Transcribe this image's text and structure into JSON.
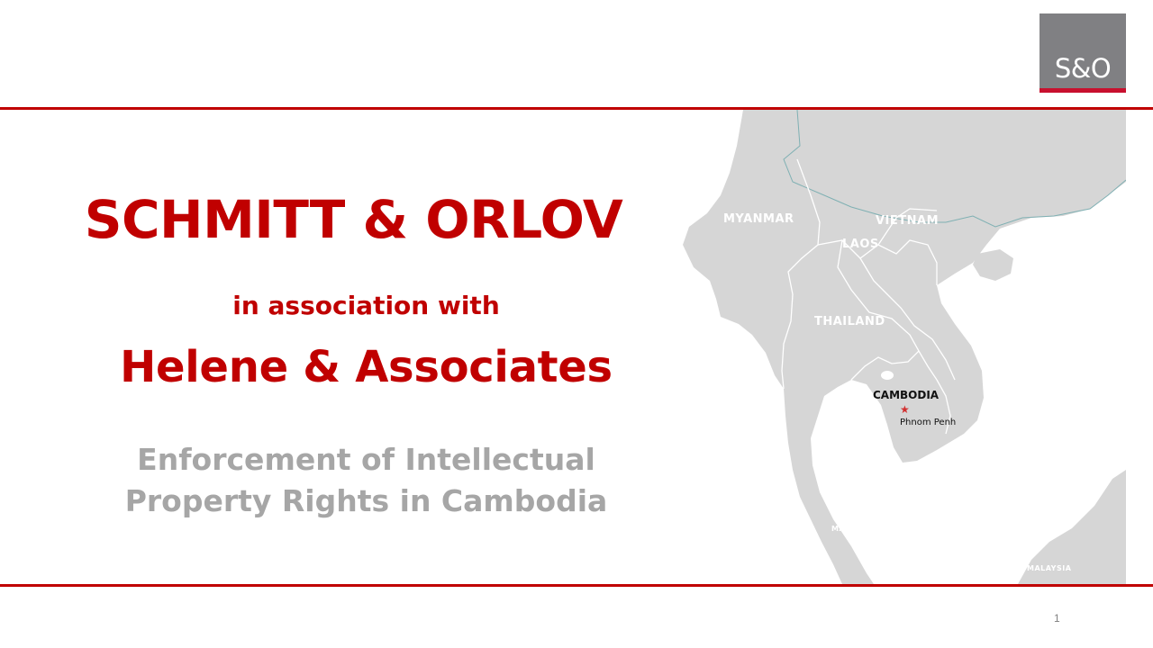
{
  "logo": {
    "text": "S&O"
  },
  "title": {
    "firm": "SCHMITT & ORLOV",
    "association": "in association with",
    "partner": "Helene & Associates"
  },
  "subtitle": {
    "line1": "Enforcement of Intellectual",
    "line2": "Property Rights in Cambodia"
  },
  "map": {
    "labels": {
      "myanmar": "MYANMAR",
      "vietnam": "VIETNAM",
      "laos": "LAOS",
      "thailand": "THAILAND",
      "cambodia": "CAMBODIA",
      "city": "Phnom Penh",
      "malaysia_west": "MALAYSIA",
      "malaysia_east": "MALAYSIA"
    }
  },
  "page": {
    "number": "1"
  },
  "colors": {
    "accent": "#c00000",
    "subtitle": "#a6a6a6",
    "land": "#d6d6d6",
    "border": "#ffffff",
    "coast_border": "#7fb0b3",
    "logo_bg": "#808083",
    "capital_star": "#d23030"
  }
}
